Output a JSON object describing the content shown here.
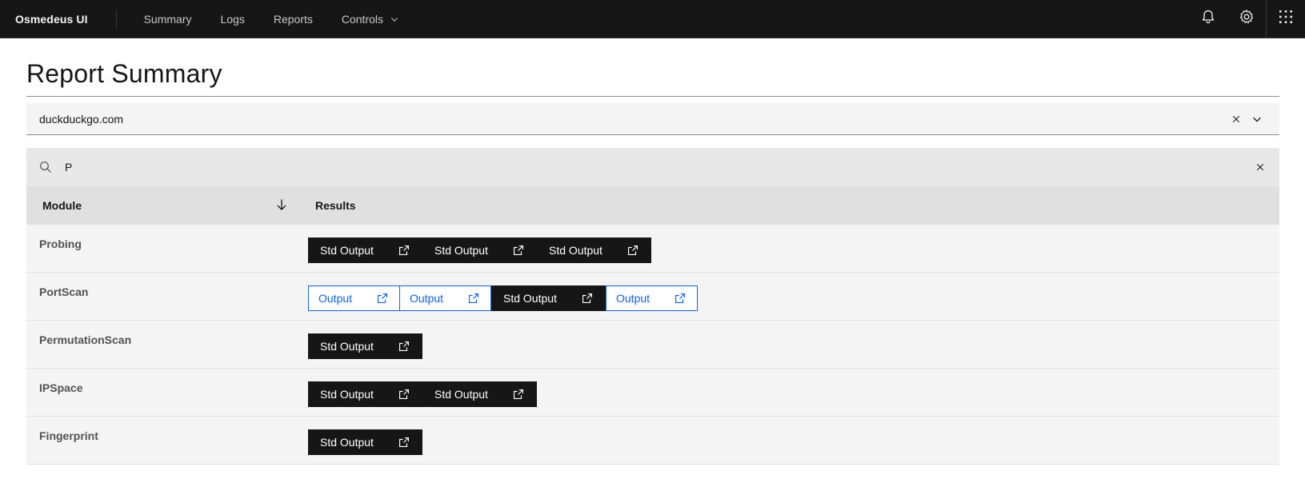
{
  "header": {
    "brand": "Osmedeus UI",
    "nav": [
      {
        "label": "Summary"
      },
      {
        "label": "Logs"
      },
      {
        "label": "Reports"
      },
      {
        "label": "Controls"
      }
    ]
  },
  "page": {
    "title": "Report Summary"
  },
  "target_select": {
    "value": "duckduckgo.com"
  },
  "table": {
    "search_value": "P",
    "headers": {
      "module": "Module",
      "results": "Results"
    },
    "rows": [
      {
        "module": "Probing",
        "buttons": [
          {
            "label": "Std Output",
            "kind": "primary"
          },
          {
            "label": "Std Output",
            "kind": "primary"
          },
          {
            "label": "Std Output",
            "kind": "primary"
          }
        ]
      },
      {
        "module": "PortScan",
        "buttons": [
          {
            "label": "Output",
            "kind": "ghost"
          },
          {
            "label": "Output",
            "kind": "ghost"
          },
          {
            "label": "Std Output",
            "kind": "primary"
          },
          {
            "label": "Output",
            "kind": "ghost"
          }
        ]
      },
      {
        "module": "PermutationScan",
        "buttons": [
          {
            "label": "Std Output",
            "kind": "primary"
          }
        ]
      },
      {
        "module": "IPSpace",
        "buttons": [
          {
            "label": "Std Output",
            "kind": "primary"
          },
          {
            "label": "Std Output",
            "kind": "primary"
          }
        ]
      },
      {
        "module": "Fingerprint",
        "buttons": [
          {
            "label": "Std Output",
            "kind": "primary"
          }
        ]
      }
    ]
  },
  "colors": {
    "header_bg": "#161616",
    "primary_button": "#161616",
    "link_blue": "#0f62fe",
    "row_bg": "#f4f4f4"
  },
  "icons": [
    "notification-icon",
    "settings-icon",
    "app-switcher-icon",
    "chevron-down-icon",
    "close-icon",
    "search-icon",
    "sort-arrow-down-icon",
    "launch-icon"
  ]
}
